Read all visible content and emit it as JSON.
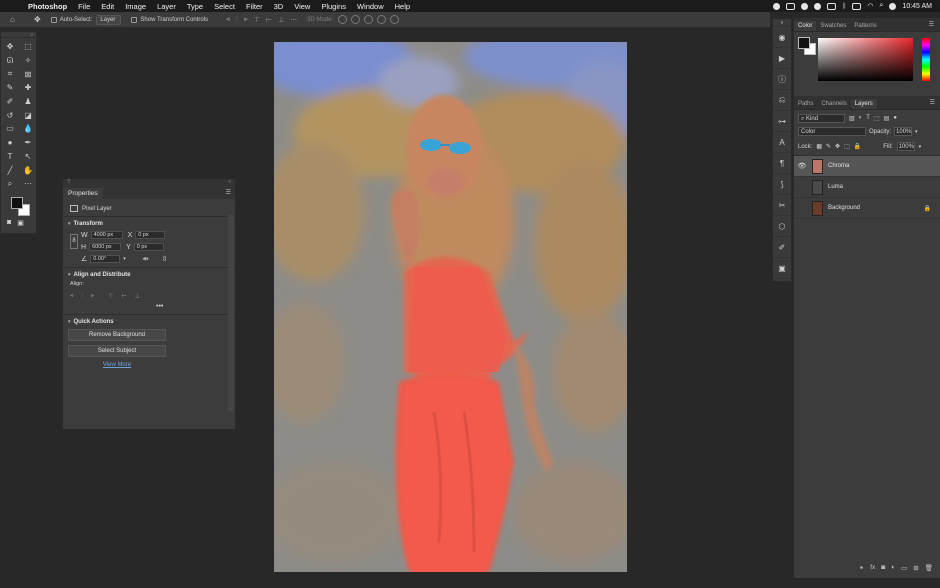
{
  "menubar": {
    "app": "Photoshop",
    "menus": [
      "File",
      "Edit",
      "Image",
      "Layer",
      "Type",
      "Select",
      "Filter",
      "3D",
      "View",
      "Plugins",
      "Window",
      "Help"
    ],
    "clock": "10:45 AM"
  },
  "options_bar": {
    "auto_select_label": "Auto-Select:",
    "auto_select_value": "Layer",
    "show_transform_label": "Show Transform Controls",
    "mode_3d_label": "3D Mode:"
  },
  "properties": {
    "tab": "Properties",
    "layer_type": "Pixel Layer",
    "transform_title": "Transform",
    "w_label": "W",
    "w_value": "4000 px",
    "h_label": "H",
    "h_value": "6000 px",
    "x_label": "X",
    "x_value": "0 px",
    "y_label": "Y",
    "y_value": "0 px",
    "angle_value": "0.00°",
    "align_title": "Align and Distribute",
    "align_label": "Align:",
    "quick_title": "Quick Actions",
    "remove_bg": "Remove Background",
    "select_subject": "Select Subject",
    "view_more": "View More"
  },
  "color_panel": {
    "tabs": [
      "Color",
      "Swatches",
      "Patterns"
    ],
    "hue_color": "#e8262a"
  },
  "layers_panel": {
    "tabs": [
      "Paths",
      "Channels",
      "Layers"
    ],
    "kind_label": "Kind",
    "blend_mode": "Color",
    "opacity_label": "Opacity:",
    "opacity_value": "100%",
    "lock_label": "Lock:",
    "fill_label": "Fill:",
    "fill_value": "100%",
    "layers": [
      {
        "name": "Chroma",
        "selected": true,
        "visible": true,
        "thumb_color": "#b9776a"
      },
      {
        "name": "Luma",
        "selected": false,
        "visible": false,
        "thumb_color": "#4a4a4a"
      },
      {
        "name": "Background",
        "selected": false,
        "visible": false,
        "thumb_color": "#6b3b2a",
        "locked": true
      }
    ]
  },
  "canvas": {
    "colors": {
      "sky": "#7b8fcd",
      "foliage": "#b48f5a",
      "dress": "#f35a4c",
      "glasses": "#3aa3d6",
      "gray": "#8d8d8d"
    }
  }
}
